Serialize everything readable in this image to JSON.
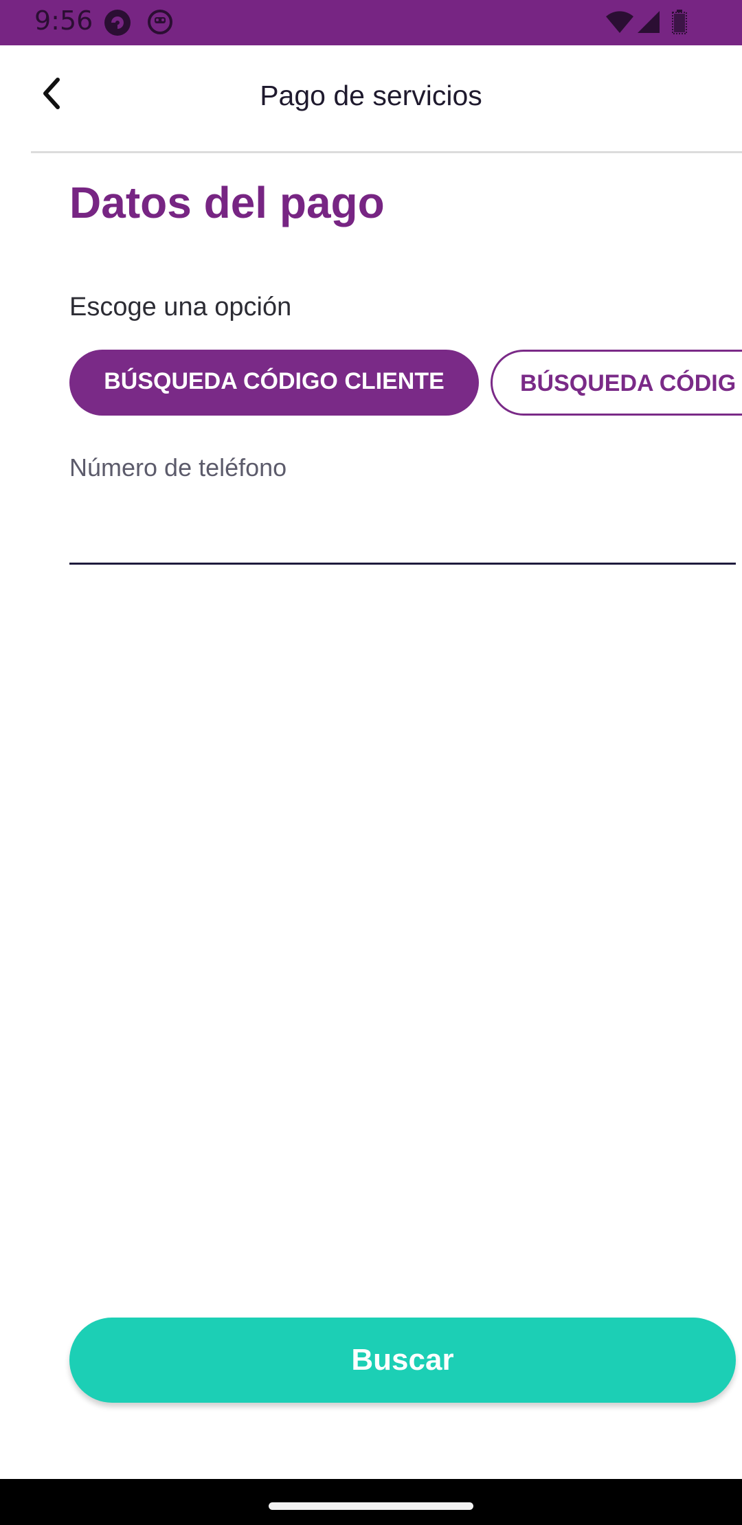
{
  "status_bar": {
    "time": "9:56",
    "icons": [
      "app-notification-icon",
      "smiley-notification-icon",
      "wifi-icon",
      "signal-icon",
      "battery-icon"
    ]
  },
  "app_bar": {
    "title": "Pago de servicios",
    "back_icon": "chevron-left-icon"
  },
  "form": {
    "heading": "Datos del pago",
    "option_label": "Escoge una opción",
    "options": [
      {
        "label": "BÚSQUEDA CÓDIGO CLIENTE",
        "selected": true
      },
      {
        "label": "BÚSQUEDA CÓDIG",
        "selected": false
      }
    ],
    "phone": {
      "label": "Número de teléfono",
      "value": ""
    },
    "submit_label": "Buscar"
  },
  "colors": {
    "primary": "#772583",
    "accent": "#1ccfb5"
  }
}
